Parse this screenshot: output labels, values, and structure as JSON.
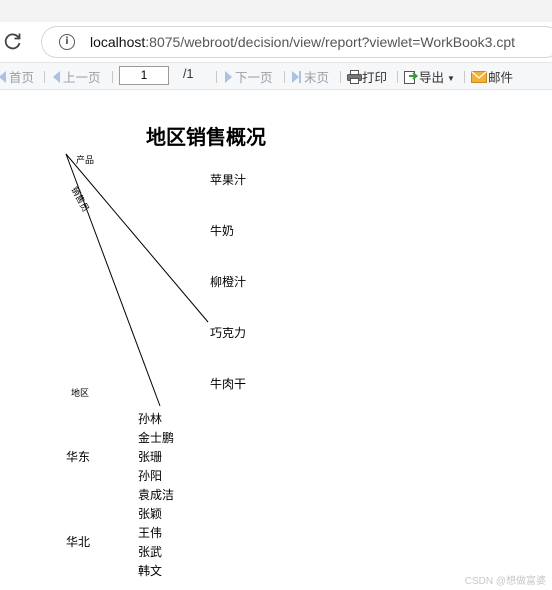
{
  "browser": {
    "url_host": "localhost",
    "url_rest": ":8075/webroot/decision/view/report?viewlet=WorkBook3.cpt"
  },
  "toolbar": {
    "first": "首页",
    "prev": "上一页",
    "page_value": "1",
    "page_total": "/1",
    "next": "下一页",
    "last": "末页",
    "print": "打印",
    "export": "导出",
    "mail": "邮件"
  },
  "report": {
    "title": "地区销售概况",
    "header_product": "产品",
    "header_salesperson": "销售员",
    "header_region": "地区",
    "products": [
      "苹果汁",
      "牛奶",
      "柳橙汁",
      "巧克力",
      "牛肉干"
    ],
    "regions": [
      {
        "name": "华东",
        "salespeople": [
          "孙林",
          "金士鹏",
          "张珊",
          "孙阳",
          "袁成洁",
          "张颖"
        ]
      },
      {
        "name": "华北",
        "salespeople": [
          "王伟",
          "张武",
          "韩文"
        ]
      }
    ]
  },
  "watermark": "CSDN @想做富婆"
}
